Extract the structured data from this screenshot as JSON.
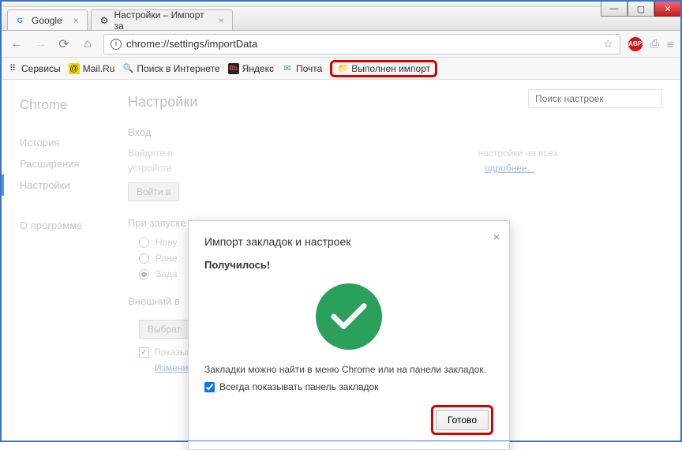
{
  "window": {
    "min": "—",
    "max": "▢",
    "close": "✕"
  },
  "tabs": [
    {
      "title": "Google",
      "icon": "G"
    },
    {
      "title": "Настройки – Импорт за",
      "icon": "⚙"
    }
  ],
  "nav": {
    "back": "←",
    "forward": "→",
    "reload": "⟳",
    "home": "⌂"
  },
  "omnibox": {
    "url": "chrome://settings/importData",
    "info": "i",
    "star": "☆"
  },
  "ext": {
    "abp": "ABP",
    "cast": "⎙",
    "menu": "≡"
  },
  "bookmarks": {
    "apps": "Сервисы",
    "mailru": "Mail.Ru",
    "search": "Поиск в Интернете",
    "yandex": "Яндекс",
    "mail": "Почта",
    "imported": "Выполнен импорт"
  },
  "sidebar": {
    "brand": "Chrome",
    "items": [
      "История",
      "Расширения",
      "Настройки"
    ],
    "about": "О программе"
  },
  "settings": {
    "title": "Настройки",
    "search_ph": "Поиск настроек",
    "signin": {
      "h": "Вход",
      "text_a": "Войдите в",
      "text_rest": "настройки на всех",
      "text_b": "устройств",
      "more": "одробнее...",
      "btn": "Войти в"
    },
    "startup": {
      "h": "При запуске",
      "opt1": "Нову",
      "opt2": "Ране",
      "opt3": "Зада"
    },
    "appearance": {
      "h": "Внешний в",
      "choose": "Выбрат",
      "home": "Показывать кнопку \"Главная страница\"",
      "change": "Изменить"
    }
  },
  "modal": {
    "title": "Импорт закладок и настроек",
    "success": "Получилось!",
    "info": "Закладки можно найти в меню Chrome или на панели закладок.",
    "chk": "Всегда показывать панель закладок",
    "done": "Готово"
  }
}
